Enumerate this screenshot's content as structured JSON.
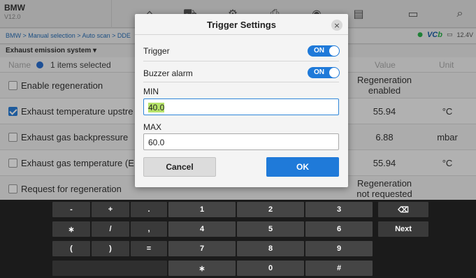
{
  "header": {
    "brand": "BMW",
    "version": "V12.0",
    "icons": [
      "home-icon",
      "vehicle-icon",
      "settings-icon",
      "print-icon",
      "help-icon",
      "save-icon",
      "message-icon",
      "search-icon"
    ]
  },
  "breadcrumb": {
    "path": "BMW > Manual selection > Auto scan > DDE",
    "vci": "VC",
    "vci_suffix": "b",
    "voltage": "12.4V"
  },
  "subheader": {
    "system": "Exhaust emission system ▾"
  },
  "table": {
    "col_name": "Name",
    "selected": "1 items selected",
    "col_value": "Value",
    "col_unit": "Unit",
    "rows": [
      {
        "name": "Enable regeneration",
        "checked": false,
        "value": "Regeneration enabled",
        "unit": ""
      },
      {
        "name": "Exhaust temperature upstre",
        "checked": true,
        "value": "55.94",
        "unit": "°C"
      },
      {
        "name": "Exhaust gas backpressure",
        "checked": false,
        "value": "6.88",
        "unit": "mbar"
      },
      {
        "name": "Exhaust gas temperature (E",
        "checked": false,
        "value": "55.94",
        "unit": "°C"
      },
      {
        "name": "Request for regeneration",
        "checked": false,
        "value": "Regeneration not requested",
        "unit": ""
      }
    ]
  },
  "dialog": {
    "title": "Trigger Settings",
    "close": "×",
    "trigger_label": "Trigger",
    "trigger_state": "ON",
    "buzzer_label": "Buzzer alarm",
    "buzzer_state": "ON",
    "min_label": "MIN",
    "min_value": "40.0",
    "max_label": "MAX",
    "max_value": "60.0",
    "cancel": "Cancel",
    "ok": "OK"
  },
  "keyboard": {
    "row1": [
      "-",
      "+",
      ".",
      "1",
      "2",
      "3"
    ],
    "row2": [
      "∗",
      "/",
      ",",
      "4",
      "5",
      "6"
    ],
    "row3": [
      "(",
      ")",
      "=",
      "7",
      "8",
      "9"
    ],
    "row4": [
      "∗",
      "0",
      "#"
    ],
    "backspace": "⌫",
    "next": "Next"
  },
  "colors": {
    "accent": "#1f7ad9",
    "highlight": "#b7e36a"
  }
}
